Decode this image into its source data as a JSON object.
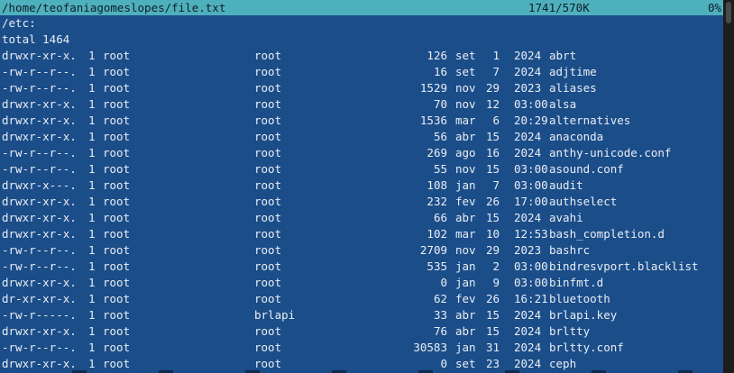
{
  "header": {
    "path": "/home/teofaniagomeslopes/file.txt",
    "size": "1741/570K",
    "percent": "0%"
  },
  "listing": {
    "dir_line": "/etc:",
    "total_line": "total 1464",
    "rows": [
      {
        "perm": "drwxr-xr-x.",
        "links": "1",
        "owner": "root",
        "group": "root",
        "size": "126",
        "month": "set",
        "day": "1",
        "time": "2024",
        "name": "abrt"
      },
      {
        "perm": "-rw-r--r--.",
        "links": "1",
        "owner": "root",
        "group": "root",
        "size": "16",
        "month": "set",
        "day": "7",
        "time": "2024",
        "name": "adjtime"
      },
      {
        "perm": "-rw-r--r--.",
        "links": "1",
        "owner": "root",
        "group": "root",
        "size": "1529",
        "month": "nov",
        "day": "29",
        "time": "2023",
        "name": "aliases"
      },
      {
        "perm": "drwxr-xr-x.",
        "links": "1",
        "owner": "root",
        "group": "root",
        "size": "70",
        "month": "nov",
        "day": "12",
        "time": "03:00",
        "name": "alsa"
      },
      {
        "perm": "drwxr-xr-x.",
        "links": "1",
        "owner": "root",
        "group": "root",
        "size": "1536",
        "month": "mar",
        "day": "6",
        "time": "20:29",
        "name": "alternatives"
      },
      {
        "perm": "drwxr-xr-x.",
        "links": "1",
        "owner": "root",
        "group": "root",
        "size": "56",
        "month": "abr",
        "day": "15",
        "time": "2024",
        "name": "anaconda"
      },
      {
        "perm": "-rw-r--r--.",
        "links": "1",
        "owner": "root",
        "group": "root",
        "size": "269",
        "month": "ago",
        "day": "16",
        "time": "2024",
        "name": "anthy-unicode.conf"
      },
      {
        "perm": "-rw-r--r--.",
        "links": "1",
        "owner": "root",
        "group": "root",
        "size": "55",
        "month": "nov",
        "day": "15",
        "time": "03:00",
        "name": "asound.conf"
      },
      {
        "perm": "drwxr-x---.",
        "links": "1",
        "owner": "root",
        "group": "root",
        "size": "108",
        "month": "jan",
        "day": "7",
        "time": "03:00",
        "name": "audit"
      },
      {
        "perm": "drwxr-xr-x.",
        "links": "1",
        "owner": "root",
        "group": "root",
        "size": "232",
        "month": "fev",
        "day": "26",
        "time": "17:00",
        "name": "authselect"
      },
      {
        "perm": "drwxr-xr-x.",
        "links": "1",
        "owner": "root",
        "group": "root",
        "size": "66",
        "month": "abr",
        "day": "15",
        "time": "2024",
        "name": "avahi"
      },
      {
        "perm": "drwxr-xr-x.",
        "links": "1",
        "owner": "root",
        "group": "root",
        "size": "102",
        "month": "mar",
        "day": "10",
        "time": "12:53",
        "name": "bash_completion.d"
      },
      {
        "perm": "-rw-r--r--.",
        "links": "1",
        "owner": "root",
        "group": "root",
        "size": "2709",
        "month": "nov",
        "day": "29",
        "time": "2023",
        "name": "bashrc"
      },
      {
        "perm": "-rw-r--r--.",
        "links": "1",
        "owner": "root",
        "group": "root",
        "size": "535",
        "month": "jan",
        "day": "2",
        "time": "03:00",
        "name": "bindresvport.blacklist"
      },
      {
        "perm": "drwxr-xr-x.",
        "links": "1",
        "owner": "root",
        "group": "root",
        "size": "0",
        "month": "jan",
        "day": "9",
        "time": "03:00",
        "name": "binfmt.d"
      },
      {
        "perm": "dr-xr-xr-x.",
        "links": "1",
        "owner": "root",
        "group": "root",
        "size": "62",
        "month": "fev",
        "day": "26",
        "time": "16:21",
        "name": "bluetooth"
      },
      {
        "perm": "-rw-r-----.",
        "links": "1",
        "owner": "root",
        "group": "brlapi",
        "size": "33",
        "month": "abr",
        "day": "15",
        "time": "2024",
        "name": "brlapi.key"
      },
      {
        "perm": "drwxr-xr-x.",
        "links": "1",
        "owner": "root",
        "group": "root",
        "size": "76",
        "month": "abr",
        "day": "15",
        "time": "2024",
        "name": "brltty"
      },
      {
        "perm": "-rw-r--r--.",
        "links": "1",
        "owner": "root",
        "group": "root",
        "size": "30583",
        "month": "jan",
        "day": "31",
        "time": "2024",
        "name": "brltty.conf"
      },
      {
        "perm": "drwxr-xr-x.",
        "links": "1",
        "owner": "root",
        "group": "root",
        "size": "0",
        "month": "set",
        "day": "23",
        "time": "2024",
        "name": "ceph"
      }
    ]
  },
  "colors": {
    "header_bg": "#4fb0bd",
    "content_bg": "#1b4d89",
    "text": "#e9eef4"
  }
}
